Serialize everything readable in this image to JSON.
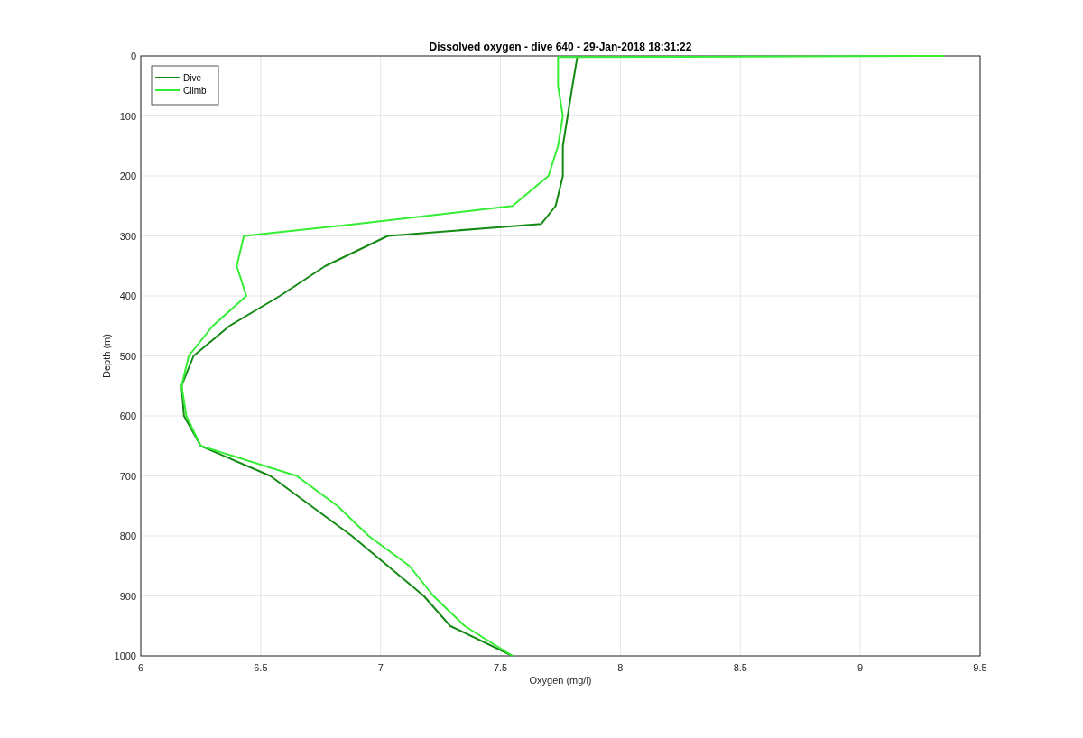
{
  "figure": {
    "chart_data": {
      "type": "line",
      "title": "Dissolved oxygen - dive 640 - 29-Jan-2018 18:31:22",
      "xlabel": "Oxygen (mg/l)",
      "ylabel": "Depth (m)",
      "orientation": "horizontal",
      "grid": true,
      "legend": true,
      "x": [
        0,
        2,
        50,
        100,
        150,
        200,
        250,
        280,
        300,
        350,
        400,
        450,
        500,
        550,
        600,
        650,
        700,
        750,
        800,
        850,
        900,
        950,
        1000
      ],
      "series": [
        {
          "name": "Dive",
          "color": "#138a13",
          "values": [
            7.82,
            7.82,
            7.8,
            7.78,
            7.76,
            7.76,
            7.73,
            7.67,
            7.03,
            6.77,
            6.58,
            6.37,
            6.22,
            6.17,
            6.18,
            6.25,
            6.54,
            6.71,
            6.88,
            7.03,
            7.18,
            7.29,
            7.55
          ]
        },
        {
          "name": "Climb",
          "color": "#33ee33",
          "values": [
            9.35,
            7.74,
            7.74,
            7.76,
            7.74,
            7.7,
            7.55,
            6.9,
            6.43,
            6.4,
            6.44,
            6.3,
            6.2,
            6.17,
            6.19,
            6.25,
            6.65,
            6.82,
            6.95,
            7.12,
            7.22,
            7.35,
            7.55
          ]
        }
      ],
      "xlim": [
        6,
        9.5
      ],
      "ylim": [
        1000,
        0
      ],
      "xticks": [
        6,
        6.5,
        7,
        7.5,
        8,
        8.5,
        9,
        9.5
      ],
      "yticks": [
        0,
        100,
        200,
        300,
        400,
        500,
        600,
        700,
        800,
        900,
        1000
      ]
    }
  }
}
